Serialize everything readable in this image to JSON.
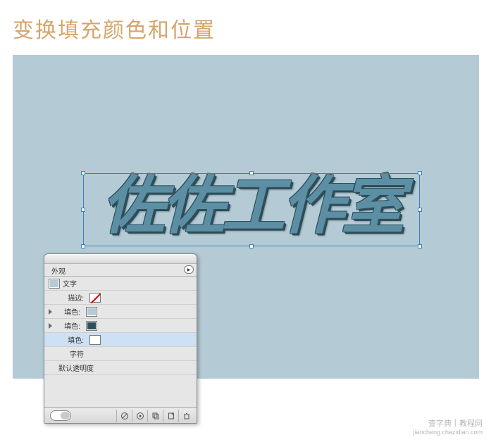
{
  "heading": "变换填充颜色和位置",
  "artwork_text": "佐佐工作室",
  "panel": {
    "tab": "外观",
    "type_label": "文字",
    "stroke_label": "描边:",
    "fill_label": "填色:",
    "chars_label": "字符",
    "opacity_label": "默认透明度",
    "swatches": {
      "main": "#b4cbd6",
      "stroke": "none",
      "fill1": "#b4cbd6",
      "fill2": "#2d4f5c",
      "fill3": "#ffffff"
    }
  },
  "watermark": {
    "line1": "查字典",
    "line2": "教程网",
    "sub": "jiaocheng.chazidian.com"
  }
}
